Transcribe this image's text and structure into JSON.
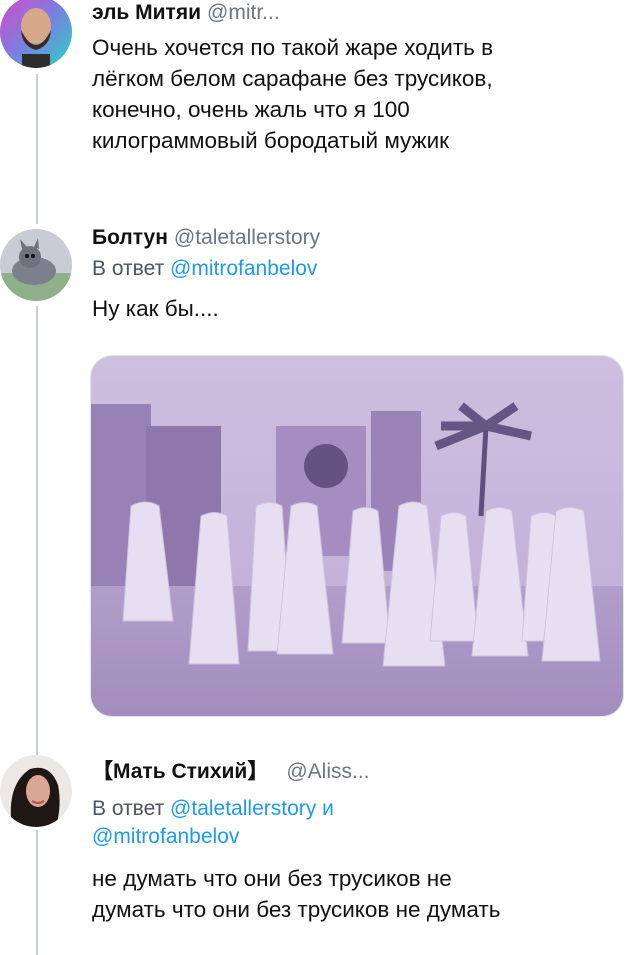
{
  "tweets": [
    {
      "name": "эль Митяи",
      "handle": "@mitr...",
      "text_lines": [
        "Очень хочется по такой жаре ходить в",
        "лёгком белом сарафане без трусиков,",
        "конечно, очень жаль что я 100",
        "килограммовый бородатый мужик"
      ]
    },
    {
      "name": "Болтун",
      "handle": "@taletallerstory",
      "reply_prefix": "В ответ",
      "reply_mention": "@mitrofanbelov",
      "text_lines": [
        "Ну как бы...."
      ]
    },
    {
      "name": "【Мать Стихий】",
      "handle": "@Aliss...",
      "reply_prefix": "В ответ",
      "reply_mention_1": "@taletallerstory",
      "reply_joiner": "и",
      "reply_mention_2": "@mitrofanbelov",
      "text_lines": [
        "не думать что они без трусиков не",
        "думать что они без трусиков не думать"
      ]
    }
  ],
  "colors": {
    "mention": "#1d9bf0",
    "handle": "#6b7780",
    "thread_line": "#c9ced3",
    "photo_tint": "#b6a6d2"
  },
  "icons": {
    "avatar1": "bald-bearded-man-avatar",
    "avatar2": "cartoon-cat-avatar",
    "avatar3": "dark-haired-woman-avatar",
    "photo": "men-in-white-robes-walking-photo"
  }
}
